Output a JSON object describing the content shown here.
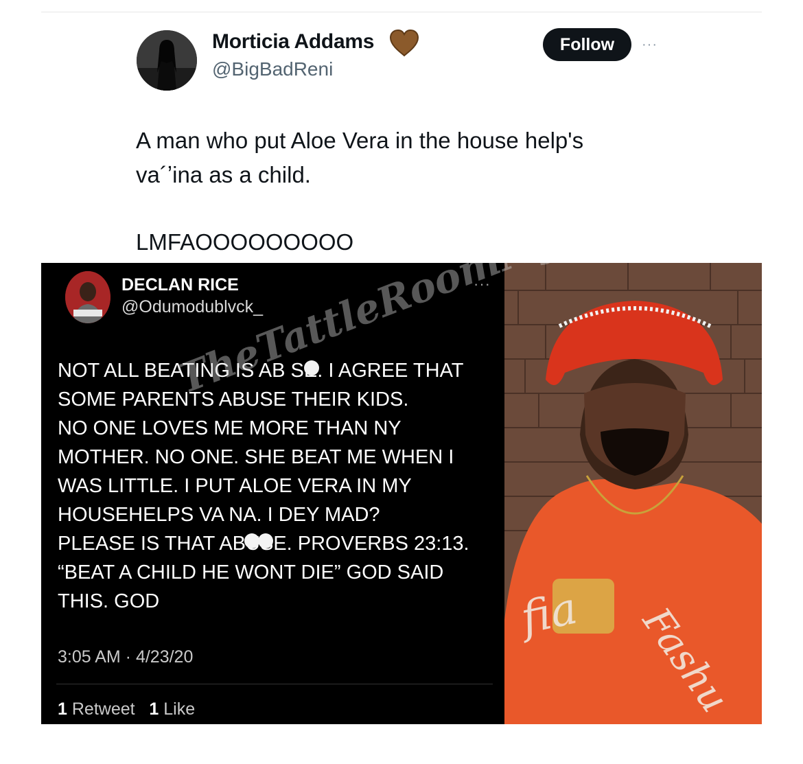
{
  "tweet": {
    "display_name": "Morticia Addams",
    "handle": "@BigBadReni",
    "follow_label": "Follow",
    "more_label": "···",
    "text_lines": [
      "A man who put Aloe Vera in the house help's",
      "va´ʼina as a child.",
      "LMFAOOOOOOOOO"
    ]
  },
  "embedded_tweet": {
    "display_name": "DECLAN RICE",
    "handle": "@Odumodublvck_",
    "more_label": "···",
    "text_lines": [
      "NOT ALL BEATING IS AB  SE. I AGREE THAT",
      "SOME PARENTS ABUSE THEIR KIDS.",
      "NO ONE LOVES ME MORE THAN NY",
      "MOTHER. NO ONE. SHE BEAT ME WHEN I",
      "WAS LITTLE. I PUT ALOE VERA IN MY",
      "HOUSEHELPS VA  NA. I DEY MAD?",
      "PLEASE IS THAT ABUSE. PROVERBS 23:13.",
      "“BEAT A CHILD HE WONT DIE” GOD SAID",
      "THIS. GOD"
    ],
    "timestamp": "3:05 AM · 4/23/20",
    "retweet_count": "1",
    "retweet_label": "Retweet",
    "like_count": "1",
    "like_label": "Like"
  },
  "watermark": "TheTattleRoomNg",
  "colors": {
    "follow_bg": "#0f1419",
    "handle": "#536471",
    "heart": "#8b5a2b",
    "embed_bg": "#000000",
    "hat": "#d9341c",
    "hoodie": "#ec5a26"
  },
  "icons": {
    "heart": "brown-heart-icon",
    "more": "more-dots-icon"
  }
}
